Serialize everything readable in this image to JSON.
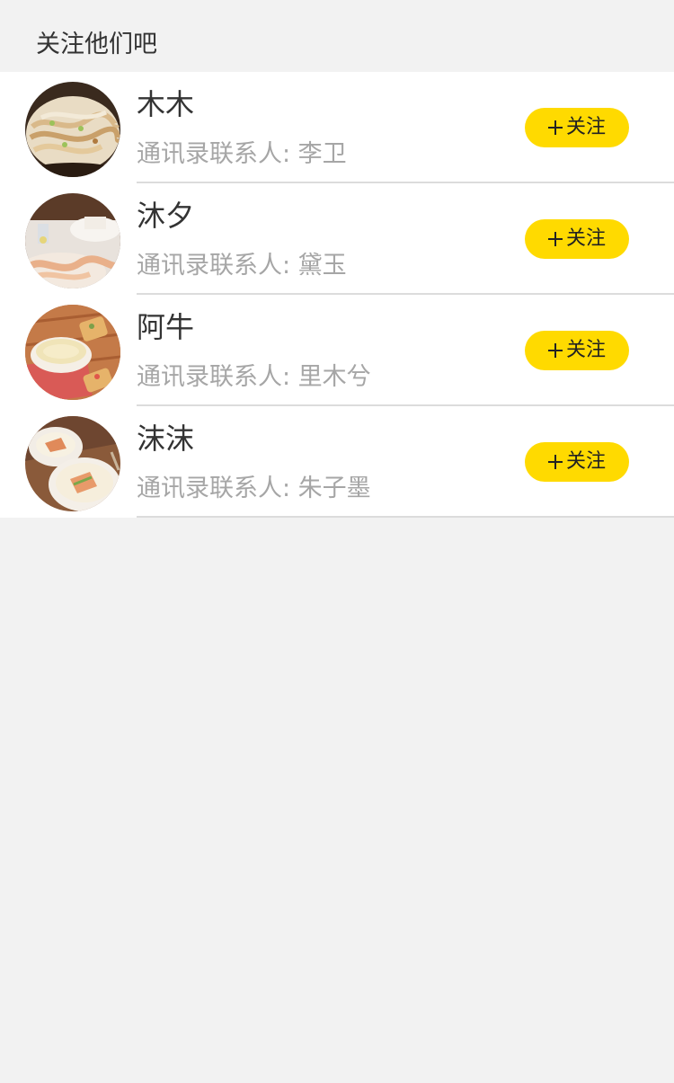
{
  "section": {
    "title": "关注他们吧"
  },
  "contacts": [
    {
      "name": "木木",
      "contact_line": "通讯录联系人:  李卫",
      "follow_label": "关注",
      "avatar_icon": "food-photo-noodles"
    },
    {
      "name": "沐夕",
      "contact_line": "通讯录联系人:  黛玉",
      "follow_label": "关注",
      "avatar_icon": "food-photo-cake"
    },
    {
      "name": "阿牛",
      "contact_line": "通讯录联系人:  里木兮",
      "follow_label": "关注",
      "avatar_icon": "food-photo-soup"
    },
    {
      "name": "沫沫",
      "contact_line": "通讯录联系人:  朱子墨",
      "follow_label": "关注",
      "avatar_icon": "food-photo-bowls"
    }
  ],
  "colors": {
    "follow_button": "#ffda00",
    "background": "#f2f2f2",
    "secondary_text": "#a6a6a6"
  }
}
